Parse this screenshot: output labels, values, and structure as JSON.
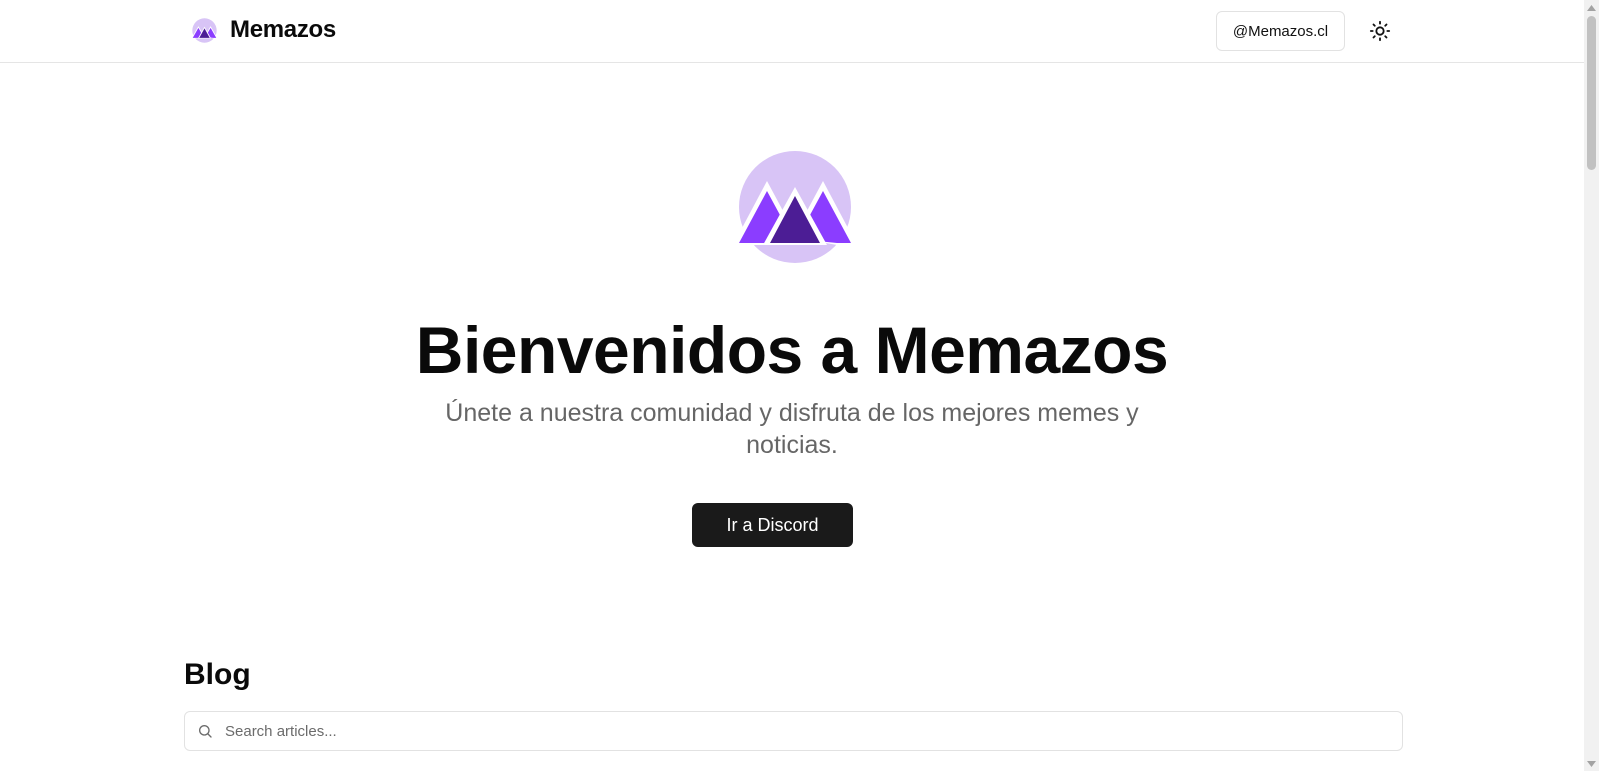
{
  "header": {
    "brand_name": "Memazos",
    "social_button_label": "@Memazos.cl",
    "theme_toggle_icon": "sun-icon"
  },
  "hero": {
    "logo_icon": "memazos-mountain-logo",
    "title": "Bienvenidos a Memazos",
    "subtitle": "Únete a nuestra comunidad y disfruta de los mejores memes y noticias.",
    "cta_label": "Ir a Discord"
  },
  "blog": {
    "heading": "Blog",
    "search_placeholder": "Search articles..."
  },
  "colors": {
    "brand_purple": "#7c3aed",
    "brand_purple_dark": "#4c1d95",
    "brand_lavender": "#d8c4f6",
    "cta_background": "#1a1a1a"
  }
}
